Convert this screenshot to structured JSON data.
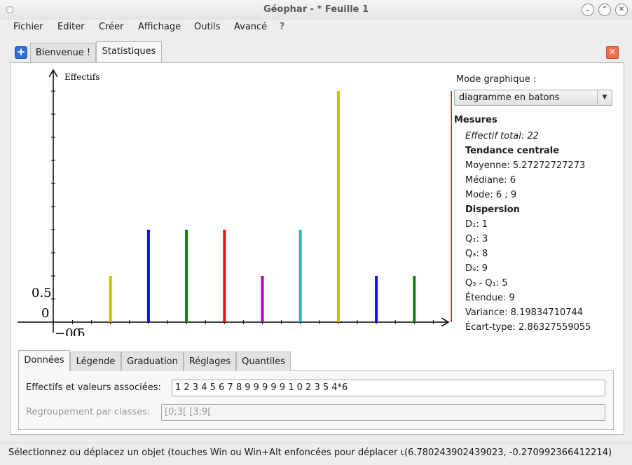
{
  "window": {
    "title": "Géophar - * Feuille 1"
  },
  "menu": [
    "Fichier",
    "Editer",
    "Créer",
    "Affichage",
    "Outils",
    "Avancé",
    "?"
  ],
  "tabs": [
    {
      "label": "Bienvenue !"
    },
    {
      "label": "Statistiques"
    }
  ],
  "chart_data": {
    "type": "bar",
    "ylabel": "Effectifs",
    "x": [
      1,
      2,
      3,
      4,
      5,
      6,
      7,
      8,
      9,
      10
    ],
    "values": [
      1,
      2,
      2,
      2,
      1,
      2,
      5,
      1,
      1,
      5
    ],
    "colors": [
      "#c8c000",
      "#1010e8",
      "#108010",
      "#e81010",
      "#b000c0",
      "#10c0c0",
      "#c8c000",
      "#1010e8",
      "#108010",
      "#e81010"
    ],
    "origin_labels": {
      "y_zero": "0",
      "y_tick": "0.5",
      "x_origin": "−0.5",
      "x_overlap": "0"
    }
  },
  "side": {
    "mode_label": "Mode graphique :",
    "mode_value": "diagramme en batons",
    "mesures_title": "Mesures",
    "effectif_total": "Effectif total: 22",
    "tendance_title": "Tendance centrale",
    "moyenne": "Moyenne: 5.27272727273",
    "mediane": "Médiane: 6",
    "mode": "Mode: 6 ; 9",
    "dispersion_title": "Dispersion",
    "d1": "D₁: 1",
    "q1": "Q₁: 3",
    "q3": "Q₃: 8",
    "d9": "D₉: 9",
    "iqr": "Q₃ - Q₁: 5",
    "etendue": "Étendue: 9",
    "variance": "Variance: 8.19834710744",
    "ecart_type": "Écart-type: 2.86327559055"
  },
  "subtabs": [
    "Données",
    "Légende",
    "Graduation",
    "Réglages",
    "Quantiles"
  ],
  "donnees": {
    "effectifs_label": "Effectifs et valeurs associées:",
    "effectifs_value": "1 2 3 4 5 6 7 8 9 9 9 9 9 1 0 2 3 5 4*6",
    "regroupement_label": "Regroupement par classes:",
    "regroupement_value": "[0;3[ [3;9["
  },
  "status": {
    "message": "Sélectionnez ou déplacez un objet (touches Win ou Win+Alt enfoncées pour déplacer un point)",
    "coords": "(6.780243902439023, -0.270992366412214)"
  }
}
